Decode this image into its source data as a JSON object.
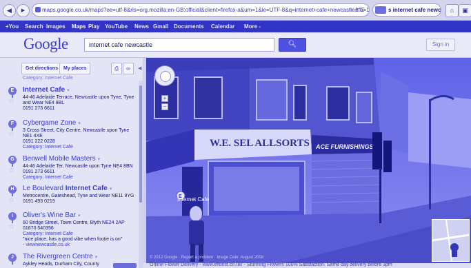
{
  "browser": {
    "url": "maps.google.co.uk/maps?oe=utf-8&rls=org.mozilla:en-GB:official&client=firefox-a&um=1&ie=UTF-8&q=internet+cafe+newcastle&fb=1&gl=uk&",
    "search_text": "s internet cafe newcast",
    "back_icon": "back-arrow-icon",
    "accent": "#3234c6"
  },
  "gbar": {
    "items": [
      "+You",
      "Search",
      "Images",
      "Maps",
      "Play",
      "YouTube",
      "News",
      "Gmail",
      "Documents",
      "Calendar",
      "More -"
    ]
  },
  "header": {
    "logo": "Google",
    "query": "internet cafe newcastle",
    "sign_in": "Sign in"
  },
  "sidebar": {
    "get_directions": "Get directions",
    "my_places": "My places",
    "cut_text": "Category: Internet Cafe",
    "results": [
      {
        "marker": "E",
        "title": "Internet Cafe",
        "lines": [
          "44-46 Adelaide Terrace, Newcastle upon Tyne, Tyne",
          "and Wear NE4 8BL",
          "0191 273 6611"
        ]
      },
      {
        "marker": "F",
        "title": "Cybergame Zone",
        "lines": [
          "3 Cross Street, City Centre, Newcastle upon Tyne",
          "NE1 4XE",
          "0191 222 0228"
        ],
        "category": "Category: Internet Cafe"
      },
      {
        "marker": "G",
        "title": "Benwell Mobile Masters",
        "lines": [
          "44-46 Adelaide Ter, Newcastle upon Tyne NE4 8BN",
          "0191 273 6611"
        ],
        "category": "Category: Internet Cafe"
      },
      {
        "marker": "H",
        "title_prefix": "Le Boulevard ",
        "title_bold": "Internet Cafe",
        "lines": [
          "Metrocentre, Gateshead, Tyne and Wear NE11 9YG",
          "0191 493 0219"
        ]
      },
      {
        "marker": "I",
        "title": "Oliver's Wine Bar",
        "lines": [
          "60 Bridge Street, Town Centre, Blyth NE24 2AP",
          "01670 540356"
        ],
        "category": "Category: Internet Cafe",
        "extra": [
          "\"nice place, has a good vibe when footie is on\"",
          "- viewnewcastle.co.uk"
        ]
      },
      {
        "marker": "J",
        "title": "The Rivergreen Centre",
        "lines": [
          "Aykley Heads, Durham City, County"
        ]
      }
    ]
  },
  "streetview": {
    "place_label": "Internet Cafe",
    "shop_sign": "W.E. SEL ALLSORTS",
    "shop_sign_2": "ACE FURNISHINGS",
    "copyright": "© 2012 Google · Report a problem · Image Date: August 2008",
    "status_text": "Online Flower Delivery - www.eflorist.co.uk/ - Stunning Flowers 100% Satisfaction. Same day delivery before 3pm"
  }
}
